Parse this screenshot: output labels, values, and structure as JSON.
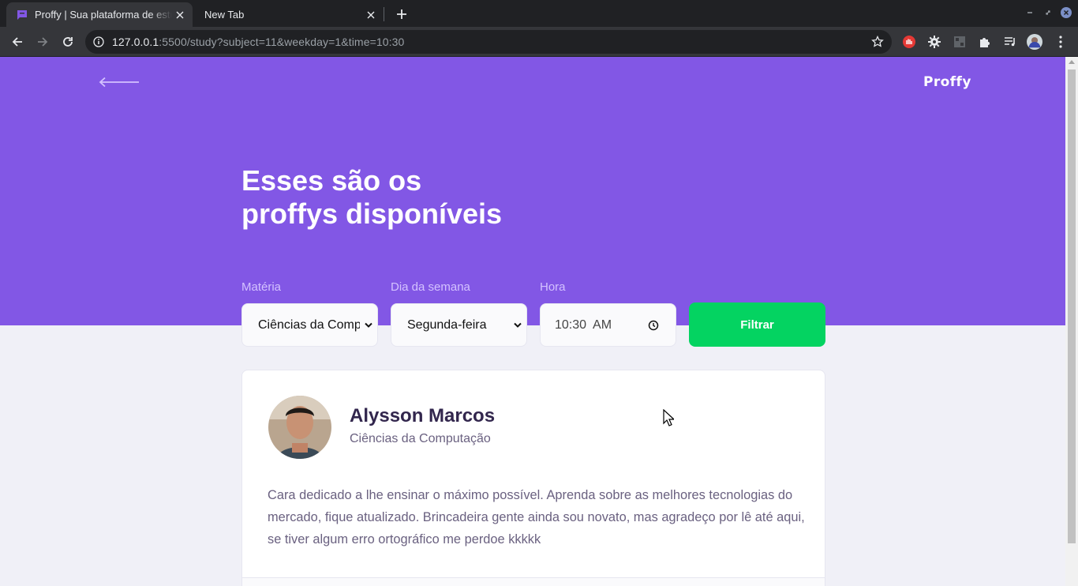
{
  "browser": {
    "tabs": [
      {
        "title": "Proffy | Sua plataforma de estudos online",
        "active": true
      },
      {
        "title": "New Tab",
        "active": false
      }
    ],
    "url": {
      "host": "127.0.0.1",
      "rest": ":5500/study?subject=11&weekday=1&time=10:30"
    }
  },
  "header": {
    "logo": "Proffy",
    "title_line1": "Esses são os",
    "title_line2": "proffys disponíveis"
  },
  "filters": {
    "subject": {
      "label": "Matéria",
      "value": "Ciências da Computação"
    },
    "weekday": {
      "label": "Dia da semana",
      "value": "Segunda-feira"
    },
    "time": {
      "label": "Hora",
      "value": "10:30  AM"
    },
    "submit_label": "Filtrar"
  },
  "teacher": {
    "name": "Alysson Marcos",
    "subject": "Ciências da Computação",
    "bio": "Cara dedicado a lhe ensinar o máximo possível. Aprenda sobre as melhores tecnologias do mercado, fique atualizado. Brincadeira gente ainda sou novato, mas agradeço por lê até aqui, se tiver algum erro ortográfico me perdoe kkkkk"
  },
  "colors": {
    "primary": "#8257e5",
    "secondary": "#04d361",
    "background": "#f0f0f7",
    "title": "#32264d",
    "text": "#6a6180"
  }
}
